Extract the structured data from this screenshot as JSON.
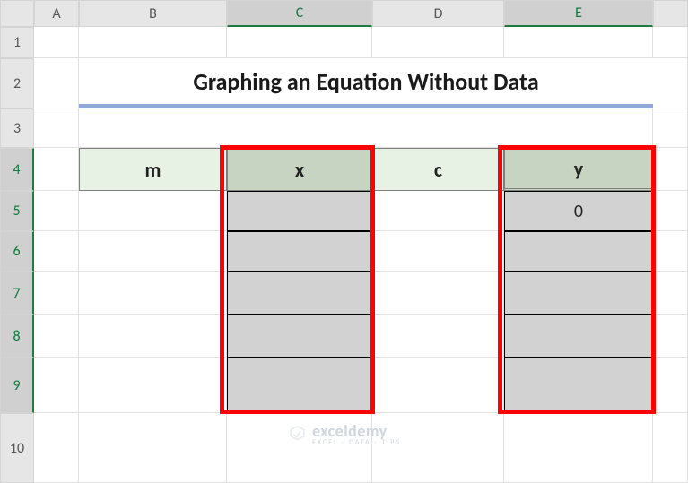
{
  "columns": [
    "A",
    "B",
    "C",
    "D",
    "E"
  ],
  "rows": [
    "1",
    "2",
    "3",
    "4",
    "5",
    "6",
    "7",
    "8",
    "9",
    "10"
  ],
  "selected_columns": [
    "C",
    "E"
  ],
  "selected_rows": [
    "4",
    "5",
    "6",
    "7",
    "8",
    "9"
  ],
  "title": "Graphing an Equation Without Data",
  "headers": {
    "B4": "m",
    "C4": "x",
    "D4": "c",
    "E4": "y"
  },
  "values": {
    "E5": "0"
  },
  "watermark": {
    "name": "exceldemy",
    "tagline": "EXCEL · DATA · TIPS"
  },
  "chart_data": {
    "type": "table",
    "title": "Graphing an Equation Without Data",
    "columns": [
      "m",
      "x",
      "c",
      "y"
    ],
    "rows": [
      {
        "m": null,
        "x": null,
        "c": null,
        "y": 0
      },
      {
        "m": null,
        "x": null,
        "c": null,
        "y": null
      },
      {
        "m": null,
        "x": null,
        "c": null,
        "y": null
      },
      {
        "m": null,
        "x": null,
        "c": null,
        "y": null
      },
      {
        "m": null,
        "x": null,
        "c": null,
        "y": null
      }
    ]
  }
}
